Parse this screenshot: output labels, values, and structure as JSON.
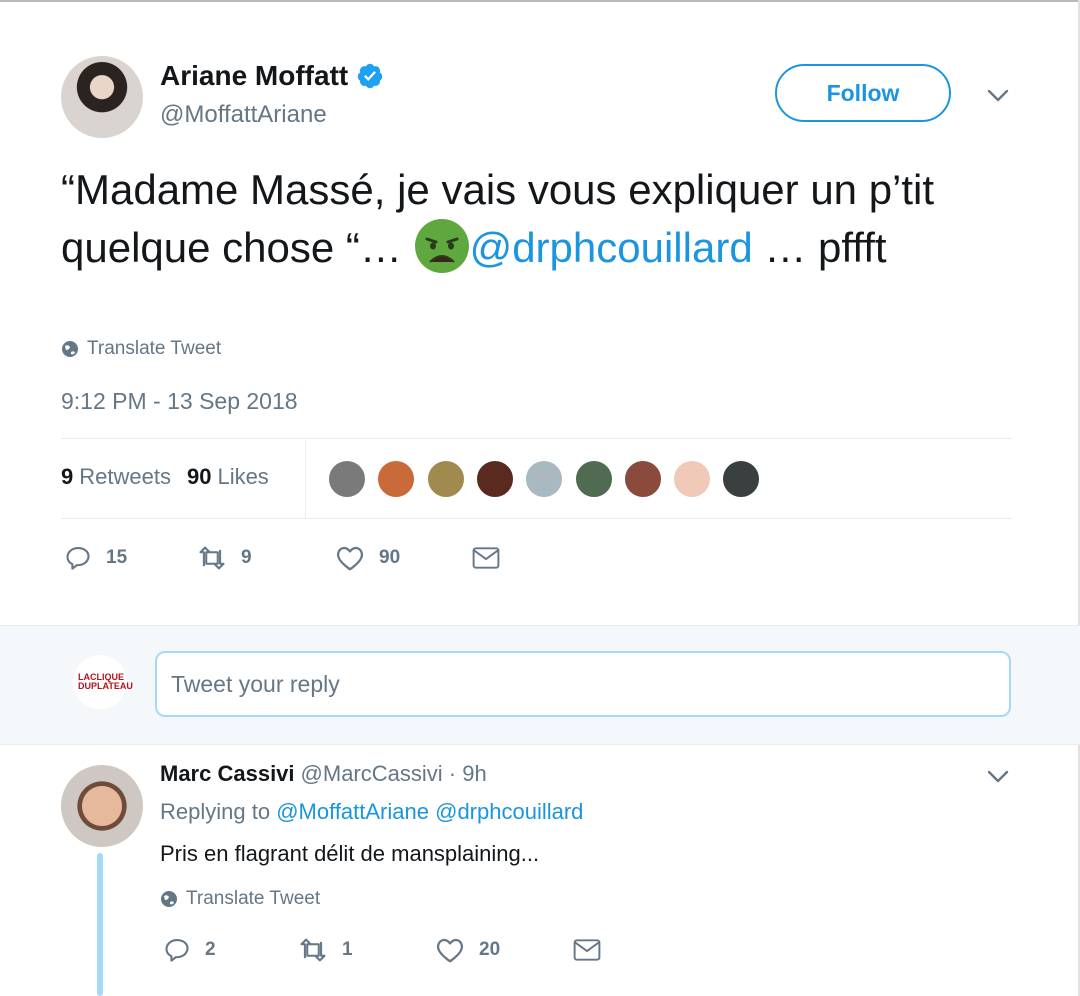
{
  "tweet": {
    "author_name": "Ariane Moffatt",
    "author_handle": "@MoffattAriane",
    "follow_label": "Follow",
    "text_before": "“Madame Massé, je vais vous expliquer un p’tit quelque chose “… ",
    "emoji_name": "nauseated-face",
    "mention": "@drphcouillard",
    "text_after": " … pffft",
    "translate_label": "Translate Tweet",
    "timestamp": "9:12 PM - 13 Sep 2018",
    "retweets_count": "9",
    "retweets_label": "Retweets",
    "likes_count": "90",
    "likes_label": "Likes",
    "actions": {
      "replies": "15",
      "retweets": "9",
      "likes": "90"
    }
  },
  "likers": [
    {
      "name": "liker-1",
      "color": "#7a7a7a"
    },
    {
      "name": "liker-2",
      "color": "#c96a3a"
    },
    {
      "name": "liker-3",
      "color": "#a08a4e"
    },
    {
      "name": "liker-4",
      "color": "#5a2a20"
    },
    {
      "name": "liker-5",
      "color": "#aab8c2"
    },
    {
      "name": "liker-6",
      "color": "#4f6b52"
    },
    {
      "name": "liker-7",
      "color": "#8a4b3c"
    },
    {
      "name": "liker-8",
      "color": "#f0c9b8"
    },
    {
      "name": "liker-9",
      "color": "#39403f"
    }
  ],
  "reply_box": {
    "placeholder": "Tweet your reply",
    "avatar_text": "LACLIQUE DUPLATEAU"
  },
  "reply": {
    "author_name": "Marc Cassivi",
    "author_handle": "@MarcCassivi",
    "time": "· 9h",
    "replying_prefix": "Replying to",
    "replying_to_1": "@MoffattAriane",
    "replying_to_2": "@drphcouillard",
    "text": "Pris en flagrant délit de mansplaining...",
    "translate_label": "Translate Tweet",
    "actions": {
      "replies": "2",
      "retweets": "1",
      "likes": "20"
    }
  },
  "colors": {
    "accent": "#1b95e0",
    "muted": "#657786",
    "text": "#14171a",
    "like": "#e0245e"
  }
}
